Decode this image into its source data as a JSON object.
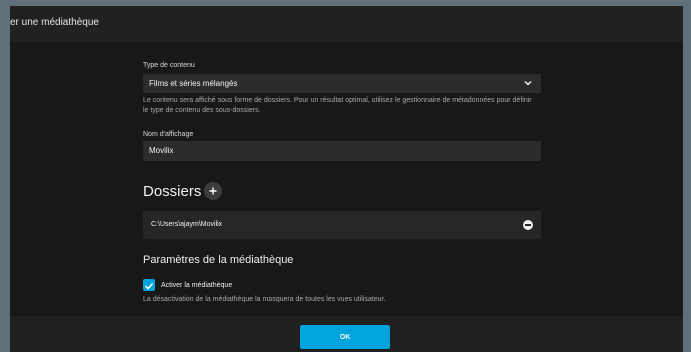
{
  "dialog": {
    "title": "er une médiathèque"
  },
  "content_type": {
    "label": "Type de contenu",
    "selected": "Films et séries mélangés",
    "hint": "Le contenu sera affiché sous forme de dossiers. Pour un résultat optimal, utilisez le gestionnaire de métadonnées pour définir le type de contenu des sous-dossiers."
  },
  "display_name": {
    "label": "Nom d'affichage",
    "value": "Movilix"
  },
  "folders": {
    "title": "Dossiers",
    "items": [
      {
        "path": "C:\\Users\\ajaym\\Movilix"
      }
    ]
  },
  "settings": {
    "title": "Paramètres de la médiathèque",
    "enable_label": "Activer la médiathèque",
    "enable_checked": true,
    "enable_hint": "La désactivation de la médiathèque la masquera de toutes les vues utilisateur."
  },
  "footer": {
    "ok_label": "OK"
  },
  "colors": {
    "accent": "#00a4dc",
    "background": "#181818"
  },
  "icons": {
    "add": "plus-icon",
    "remove": "minus-circle-icon",
    "dropdown": "chevron-down-icon",
    "checkbox": "check-icon"
  }
}
